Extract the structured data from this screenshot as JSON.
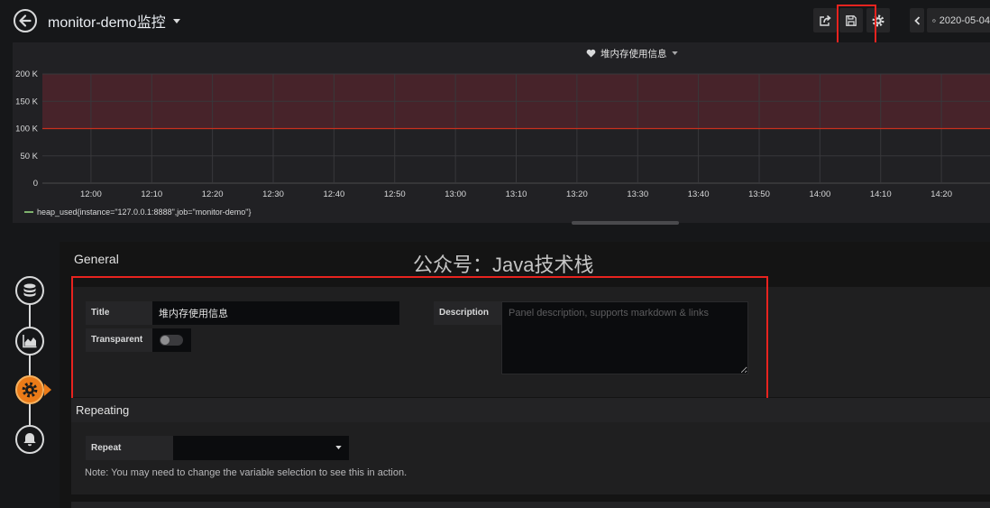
{
  "header": {
    "dashboard_title": "monitor-demo监控",
    "time_range_label": "2020-05-04"
  },
  "panel": {
    "title": "堆内存使用信息"
  },
  "chart_data": {
    "type": "line",
    "x_ticks": [
      "12:00",
      "12:10",
      "12:20",
      "12:30",
      "12:40",
      "12:50",
      "13:00",
      "13:10",
      "13:20",
      "13:30",
      "13:40",
      "13:50",
      "14:00",
      "14:10",
      "14:20"
    ],
    "xlim": [
      "11:52",
      "14:28"
    ],
    "y_ticks": [
      {
        "value": 200000,
        "label": "200 K"
      },
      {
        "value": 150000,
        "label": "150 K"
      },
      {
        "value": 100000,
        "label": "100 K"
      },
      {
        "value": 50000,
        "label": "50 K"
      },
      {
        "value": 0,
        "label": "0"
      }
    ],
    "ylim": [
      0,
      200000
    ],
    "threshold": {
      "value": 100000,
      "fill": "above",
      "color": "#e02f44"
    },
    "series": [
      {
        "name": "heap_used{instance=\"127.0.0.1:8888\",job=\"monitor-demo\"}",
        "color": "#7eb26d",
        "values": []
      }
    ],
    "grid": true,
    "legend": "bottom-left"
  },
  "editor": {
    "general": {
      "heading": "General",
      "title_label": "Title",
      "title_value": "堆内存使用信息",
      "transparent_label": "Transparent",
      "transparent_on": false,
      "description_label": "Description",
      "description_placeholder": "Panel description, supports markdown & links"
    },
    "repeating": {
      "heading": "Repeating",
      "repeat_label": "Repeat",
      "repeat_value": "",
      "note": "Note: You may need to change the variable selection to see this in action."
    }
  },
  "watermark": "公众号：Java技术栈",
  "icons": {
    "back": "arrow-left-icon",
    "share": "share-icon",
    "save": "save-icon",
    "settings": "gear-icon",
    "time_back": "chevron-left-icon",
    "clock": "clock-icon",
    "panel_title": "heart-icon",
    "steps": [
      "database-icon",
      "area-chart-icon",
      "gear-icon",
      "bell-icon"
    ]
  },
  "colors": {
    "active_step": "#eb7b18",
    "highlight": "#e8231f",
    "panel_bg": "#212124"
  }
}
